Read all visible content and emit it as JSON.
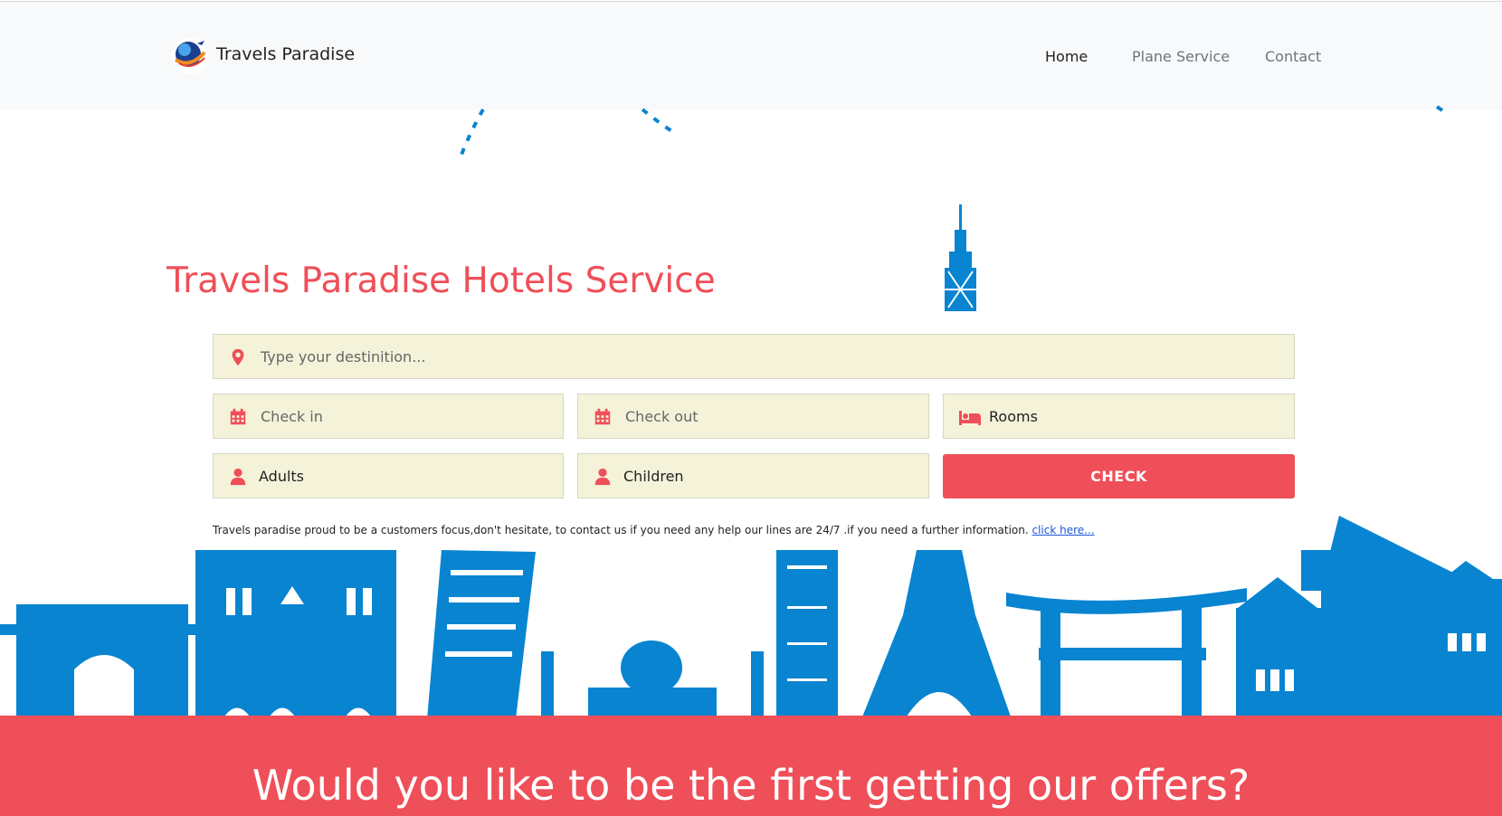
{
  "brand": {
    "name": "Travels Paradise"
  },
  "nav": [
    {
      "label": "Home",
      "active": true
    },
    {
      "label": "Plane Service",
      "active": false
    },
    {
      "label": "Contact",
      "active": false
    }
  ],
  "hero": {
    "title": "Travels Paradise Hotels Service"
  },
  "form": {
    "destination_placeholder": "Type your destinition...",
    "checkin_placeholder": "Check in",
    "checkout_placeholder": "Check out",
    "rooms_label": "Rooms",
    "adults_label": "Adults",
    "children_label": "Children",
    "check_button": "CHECK"
  },
  "info": {
    "text": "Travels paradise proud to be a customers focus,don't hesitate, to contact us if you need any help our lines are 24/7 .if you need a further information.",
    "link": "click here..."
  },
  "cta": {
    "title": "Would you like to be the first getting our offers?"
  },
  "colors": {
    "accent": "#ef4f58",
    "skyline": "#0884d1",
    "field_bg": "#f4f3da",
    "navbar_bg": "#f8f9fa"
  },
  "icons": [
    "globe-logo-icon",
    "map-marker-icon",
    "calendar-icon",
    "bed-icon",
    "user-icon"
  ]
}
